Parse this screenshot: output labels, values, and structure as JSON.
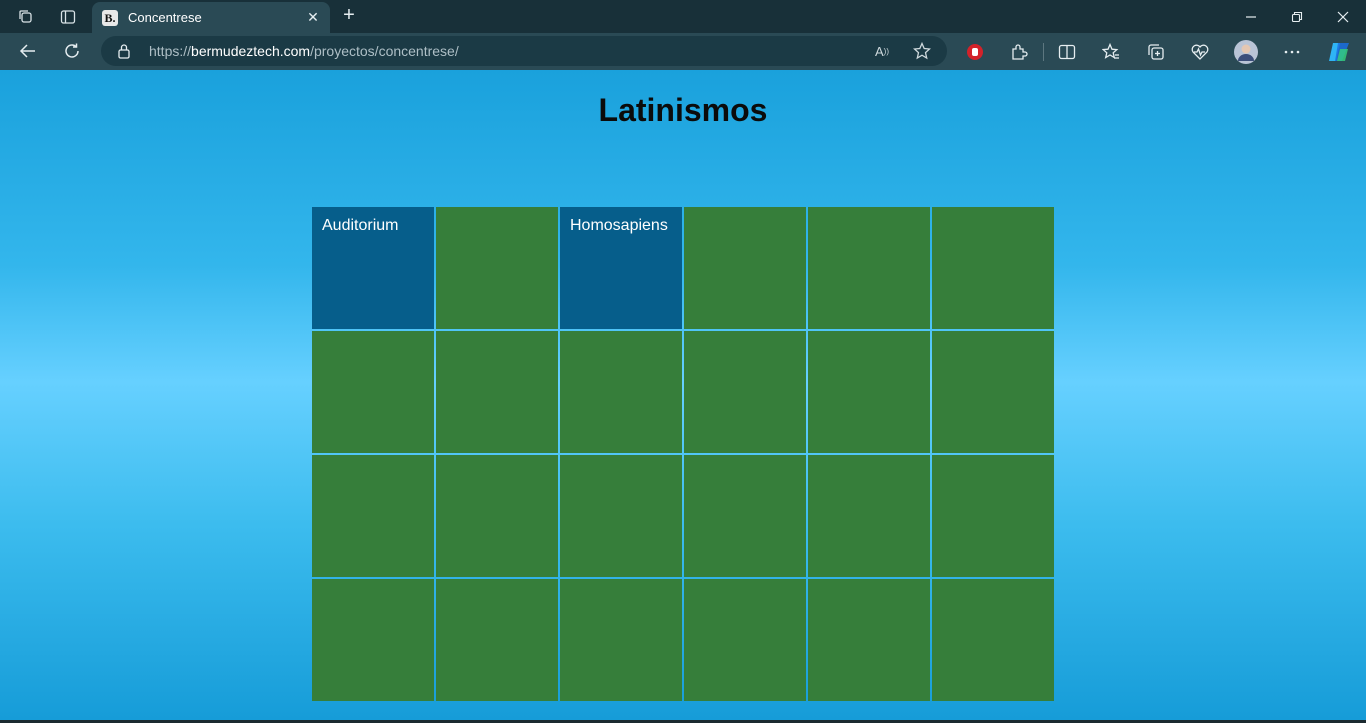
{
  "browser": {
    "tab": {
      "title": "Concentrese",
      "favicon_text": "B."
    },
    "url": {
      "scheme": "https://",
      "host": "bermudeztech.com",
      "path": "/proyectos/concentrese/"
    },
    "read_aloud_label": "A",
    "colors": {
      "tabstrip": "#183039",
      "toolbar": "#2a4a55",
      "addressbar": "#1b3a45"
    }
  },
  "page": {
    "title": "Latinismos",
    "colors": {
      "card_hidden": "#367e3a",
      "card_revealed": "#065e8b",
      "background": "#66d0ff"
    },
    "board": {
      "columns": 6,
      "rows": 4,
      "cards": [
        {
          "label": "Auditorium",
          "revealed": true
        },
        {
          "label": "",
          "revealed": false
        },
        {
          "label": "Homosapiens",
          "revealed": true
        },
        {
          "label": "",
          "revealed": false
        },
        {
          "label": "",
          "revealed": false
        },
        {
          "label": "",
          "revealed": false
        },
        {
          "label": "",
          "revealed": false
        },
        {
          "label": "",
          "revealed": false
        },
        {
          "label": "",
          "revealed": false
        },
        {
          "label": "",
          "revealed": false
        },
        {
          "label": "",
          "revealed": false
        },
        {
          "label": "",
          "revealed": false
        },
        {
          "label": "",
          "revealed": false
        },
        {
          "label": "",
          "revealed": false
        },
        {
          "label": "",
          "revealed": false
        },
        {
          "label": "",
          "revealed": false
        },
        {
          "label": "",
          "revealed": false
        },
        {
          "label": "",
          "revealed": false
        },
        {
          "label": "",
          "revealed": false
        },
        {
          "label": "",
          "revealed": false
        },
        {
          "label": "",
          "revealed": false
        },
        {
          "label": "",
          "revealed": false
        },
        {
          "label": "",
          "revealed": false
        },
        {
          "label": "",
          "revealed": false
        }
      ]
    }
  }
}
